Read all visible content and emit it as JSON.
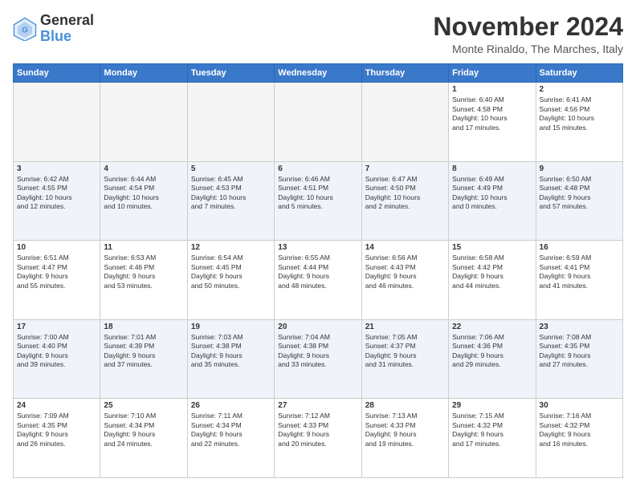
{
  "logo": {
    "line1": "General",
    "line2": "Blue"
  },
  "title": "November 2024",
  "location": "Monte Rinaldo, The Marches, Italy",
  "weekdays": [
    "Sunday",
    "Monday",
    "Tuesday",
    "Wednesday",
    "Thursday",
    "Friday",
    "Saturday"
  ],
  "weeks": [
    [
      {
        "day": "",
        "info": ""
      },
      {
        "day": "",
        "info": ""
      },
      {
        "day": "",
        "info": ""
      },
      {
        "day": "",
        "info": ""
      },
      {
        "day": "",
        "info": ""
      },
      {
        "day": "1",
        "info": "Sunrise: 6:40 AM\nSunset: 4:58 PM\nDaylight: 10 hours\nand 17 minutes."
      },
      {
        "day": "2",
        "info": "Sunrise: 6:41 AM\nSunset: 4:56 PM\nDaylight: 10 hours\nand 15 minutes."
      }
    ],
    [
      {
        "day": "3",
        "info": "Sunrise: 6:42 AM\nSunset: 4:55 PM\nDaylight: 10 hours\nand 12 minutes."
      },
      {
        "day": "4",
        "info": "Sunrise: 6:44 AM\nSunset: 4:54 PM\nDaylight: 10 hours\nand 10 minutes."
      },
      {
        "day": "5",
        "info": "Sunrise: 6:45 AM\nSunset: 4:53 PM\nDaylight: 10 hours\nand 7 minutes."
      },
      {
        "day": "6",
        "info": "Sunrise: 6:46 AM\nSunset: 4:51 PM\nDaylight: 10 hours\nand 5 minutes."
      },
      {
        "day": "7",
        "info": "Sunrise: 6:47 AM\nSunset: 4:50 PM\nDaylight: 10 hours\nand 2 minutes."
      },
      {
        "day": "8",
        "info": "Sunrise: 6:49 AM\nSunset: 4:49 PM\nDaylight: 10 hours\nand 0 minutes."
      },
      {
        "day": "9",
        "info": "Sunrise: 6:50 AM\nSunset: 4:48 PM\nDaylight: 9 hours\nand 57 minutes."
      }
    ],
    [
      {
        "day": "10",
        "info": "Sunrise: 6:51 AM\nSunset: 4:47 PM\nDaylight: 9 hours\nand 55 minutes."
      },
      {
        "day": "11",
        "info": "Sunrise: 6:53 AM\nSunset: 4:46 PM\nDaylight: 9 hours\nand 53 minutes."
      },
      {
        "day": "12",
        "info": "Sunrise: 6:54 AM\nSunset: 4:45 PM\nDaylight: 9 hours\nand 50 minutes."
      },
      {
        "day": "13",
        "info": "Sunrise: 6:55 AM\nSunset: 4:44 PM\nDaylight: 9 hours\nand 48 minutes."
      },
      {
        "day": "14",
        "info": "Sunrise: 6:56 AM\nSunset: 4:43 PM\nDaylight: 9 hours\nand 46 minutes."
      },
      {
        "day": "15",
        "info": "Sunrise: 6:58 AM\nSunset: 4:42 PM\nDaylight: 9 hours\nand 44 minutes."
      },
      {
        "day": "16",
        "info": "Sunrise: 6:59 AM\nSunset: 4:41 PM\nDaylight: 9 hours\nand 41 minutes."
      }
    ],
    [
      {
        "day": "17",
        "info": "Sunrise: 7:00 AM\nSunset: 4:40 PM\nDaylight: 9 hours\nand 39 minutes."
      },
      {
        "day": "18",
        "info": "Sunrise: 7:01 AM\nSunset: 4:39 PM\nDaylight: 9 hours\nand 37 minutes."
      },
      {
        "day": "19",
        "info": "Sunrise: 7:03 AM\nSunset: 4:38 PM\nDaylight: 9 hours\nand 35 minutes."
      },
      {
        "day": "20",
        "info": "Sunrise: 7:04 AM\nSunset: 4:38 PM\nDaylight: 9 hours\nand 33 minutes."
      },
      {
        "day": "21",
        "info": "Sunrise: 7:05 AM\nSunset: 4:37 PM\nDaylight: 9 hours\nand 31 minutes."
      },
      {
        "day": "22",
        "info": "Sunrise: 7:06 AM\nSunset: 4:36 PM\nDaylight: 9 hours\nand 29 minutes."
      },
      {
        "day": "23",
        "info": "Sunrise: 7:08 AM\nSunset: 4:35 PM\nDaylight: 9 hours\nand 27 minutes."
      }
    ],
    [
      {
        "day": "24",
        "info": "Sunrise: 7:09 AM\nSunset: 4:35 PM\nDaylight: 9 hours\nand 26 minutes."
      },
      {
        "day": "25",
        "info": "Sunrise: 7:10 AM\nSunset: 4:34 PM\nDaylight: 9 hours\nand 24 minutes."
      },
      {
        "day": "26",
        "info": "Sunrise: 7:11 AM\nSunset: 4:34 PM\nDaylight: 9 hours\nand 22 minutes."
      },
      {
        "day": "27",
        "info": "Sunrise: 7:12 AM\nSunset: 4:33 PM\nDaylight: 9 hours\nand 20 minutes."
      },
      {
        "day": "28",
        "info": "Sunrise: 7:13 AM\nSunset: 4:33 PM\nDaylight: 9 hours\nand 19 minutes."
      },
      {
        "day": "29",
        "info": "Sunrise: 7:15 AM\nSunset: 4:32 PM\nDaylight: 9 hours\nand 17 minutes."
      },
      {
        "day": "30",
        "info": "Sunrise: 7:16 AM\nSunset: 4:32 PM\nDaylight: 9 hours\nand 16 minutes."
      }
    ]
  ]
}
